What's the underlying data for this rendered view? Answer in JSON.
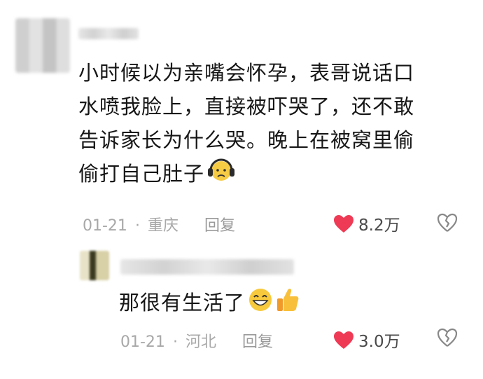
{
  "comment": {
    "lines": [
      "小时候以为亲嘴会怀孕，表哥说话口",
      "水喷我脸上，直接被吓哭了，还不敢",
      "告诉家长为什么哭。晚上在被窝里偷",
      "偷打自己肚子"
    ],
    "date": "01-21",
    "separator": "·",
    "location": "重庆",
    "reply_label": "回复",
    "likes": "8.2万",
    "emoji_icon": "headphones-face-icon"
  },
  "reply": {
    "text": "那很有生活了",
    "date": "01-21",
    "separator": "·",
    "location": "河北",
    "reply_label": "回复",
    "likes": "3.0万",
    "emoji_icons": [
      "grin-face-icon",
      "thumbs-up-icon"
    ]
  },
  "colors": {
    "like_heart": "#ee3a55",
    "meta_text": "#a8a8a8"
  }
}
